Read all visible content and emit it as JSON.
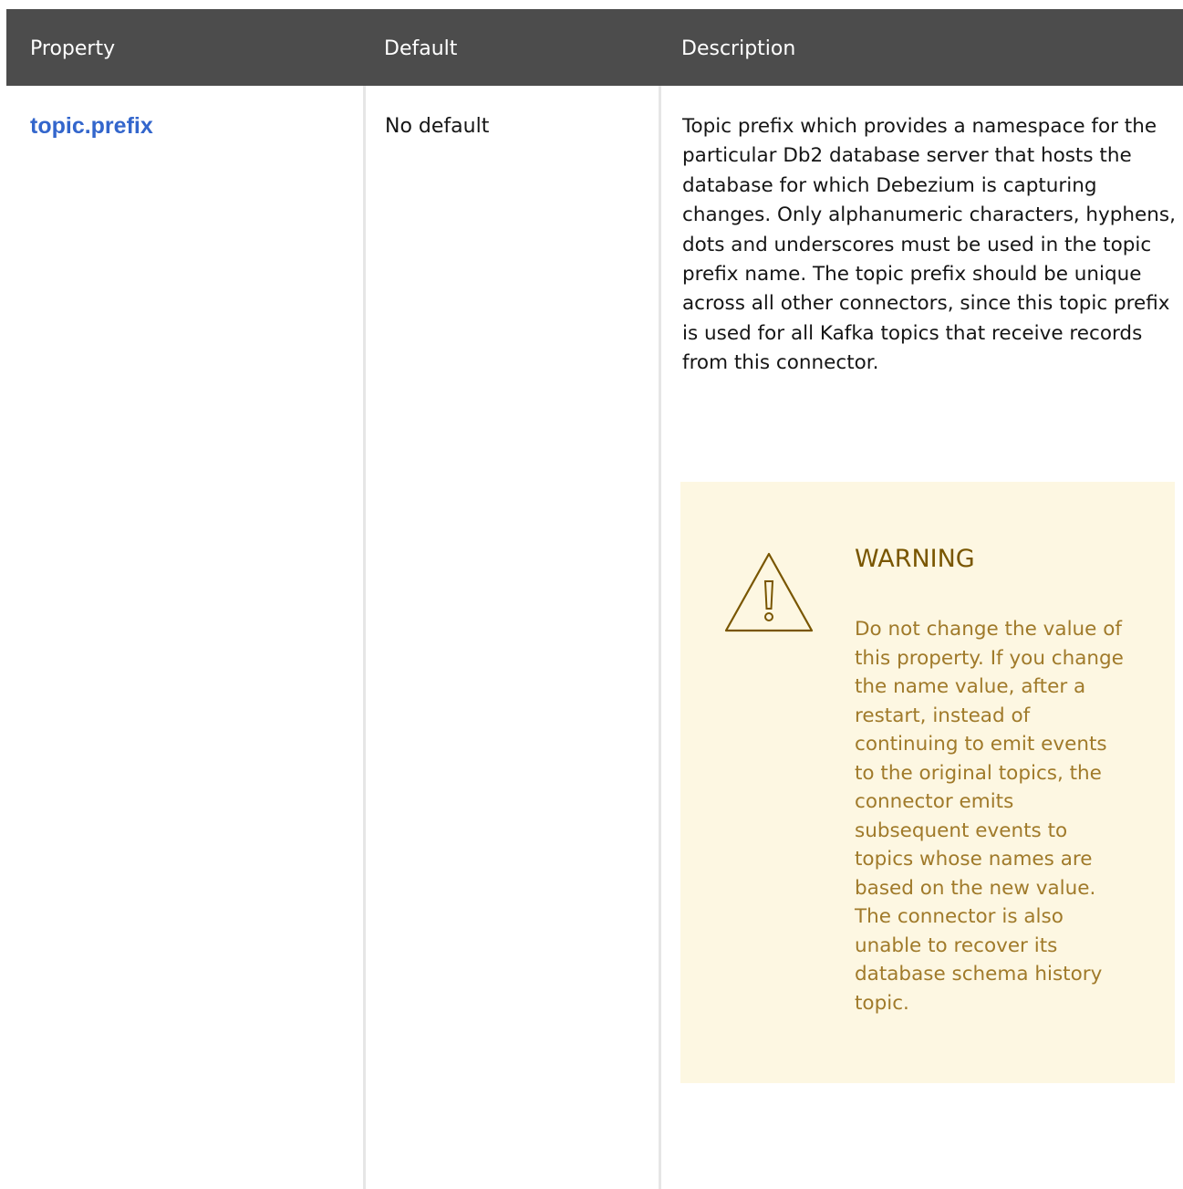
{
  "table": {
    "headers": {
      "property": "Property",
      "default": "Default",
      "description": "Description"
    },
    "rows": [
      {
        "property": "topic.prefix",
        "default": "No default",
        "description": "Topic prefix which provides a namespace for the particular Db2 database server that hosts the database for which Debezium is capturing changes. Only alphanumeric characters, hyphens, dots and underscores must be used in the topic prefix name. The topic prefix should be unique across all other connectors, since this topic prefix is used for all Kafka topics that receive records from this connector.",
        "admonition": {
          "icon": "warning-triangle-icon",
          "title": "WARNING",
          "body": "Do not change the value of this property. If you change the name value, after a restart, instead of continuing to emit events to the original topics, the connector emits subsequent events to topics whose names are based on the new value. The connector is also unable to recover its database schema history topic."
        }
      }
    ]
  },
  "colors": {
    "header_bg": "#4c4c4c",
    "link": "#3366cc",
    "warning_bg": "#fdf7e2",
    "warning_title": "#795600",
    "warning_text": "#a07a2a"
  }
}
